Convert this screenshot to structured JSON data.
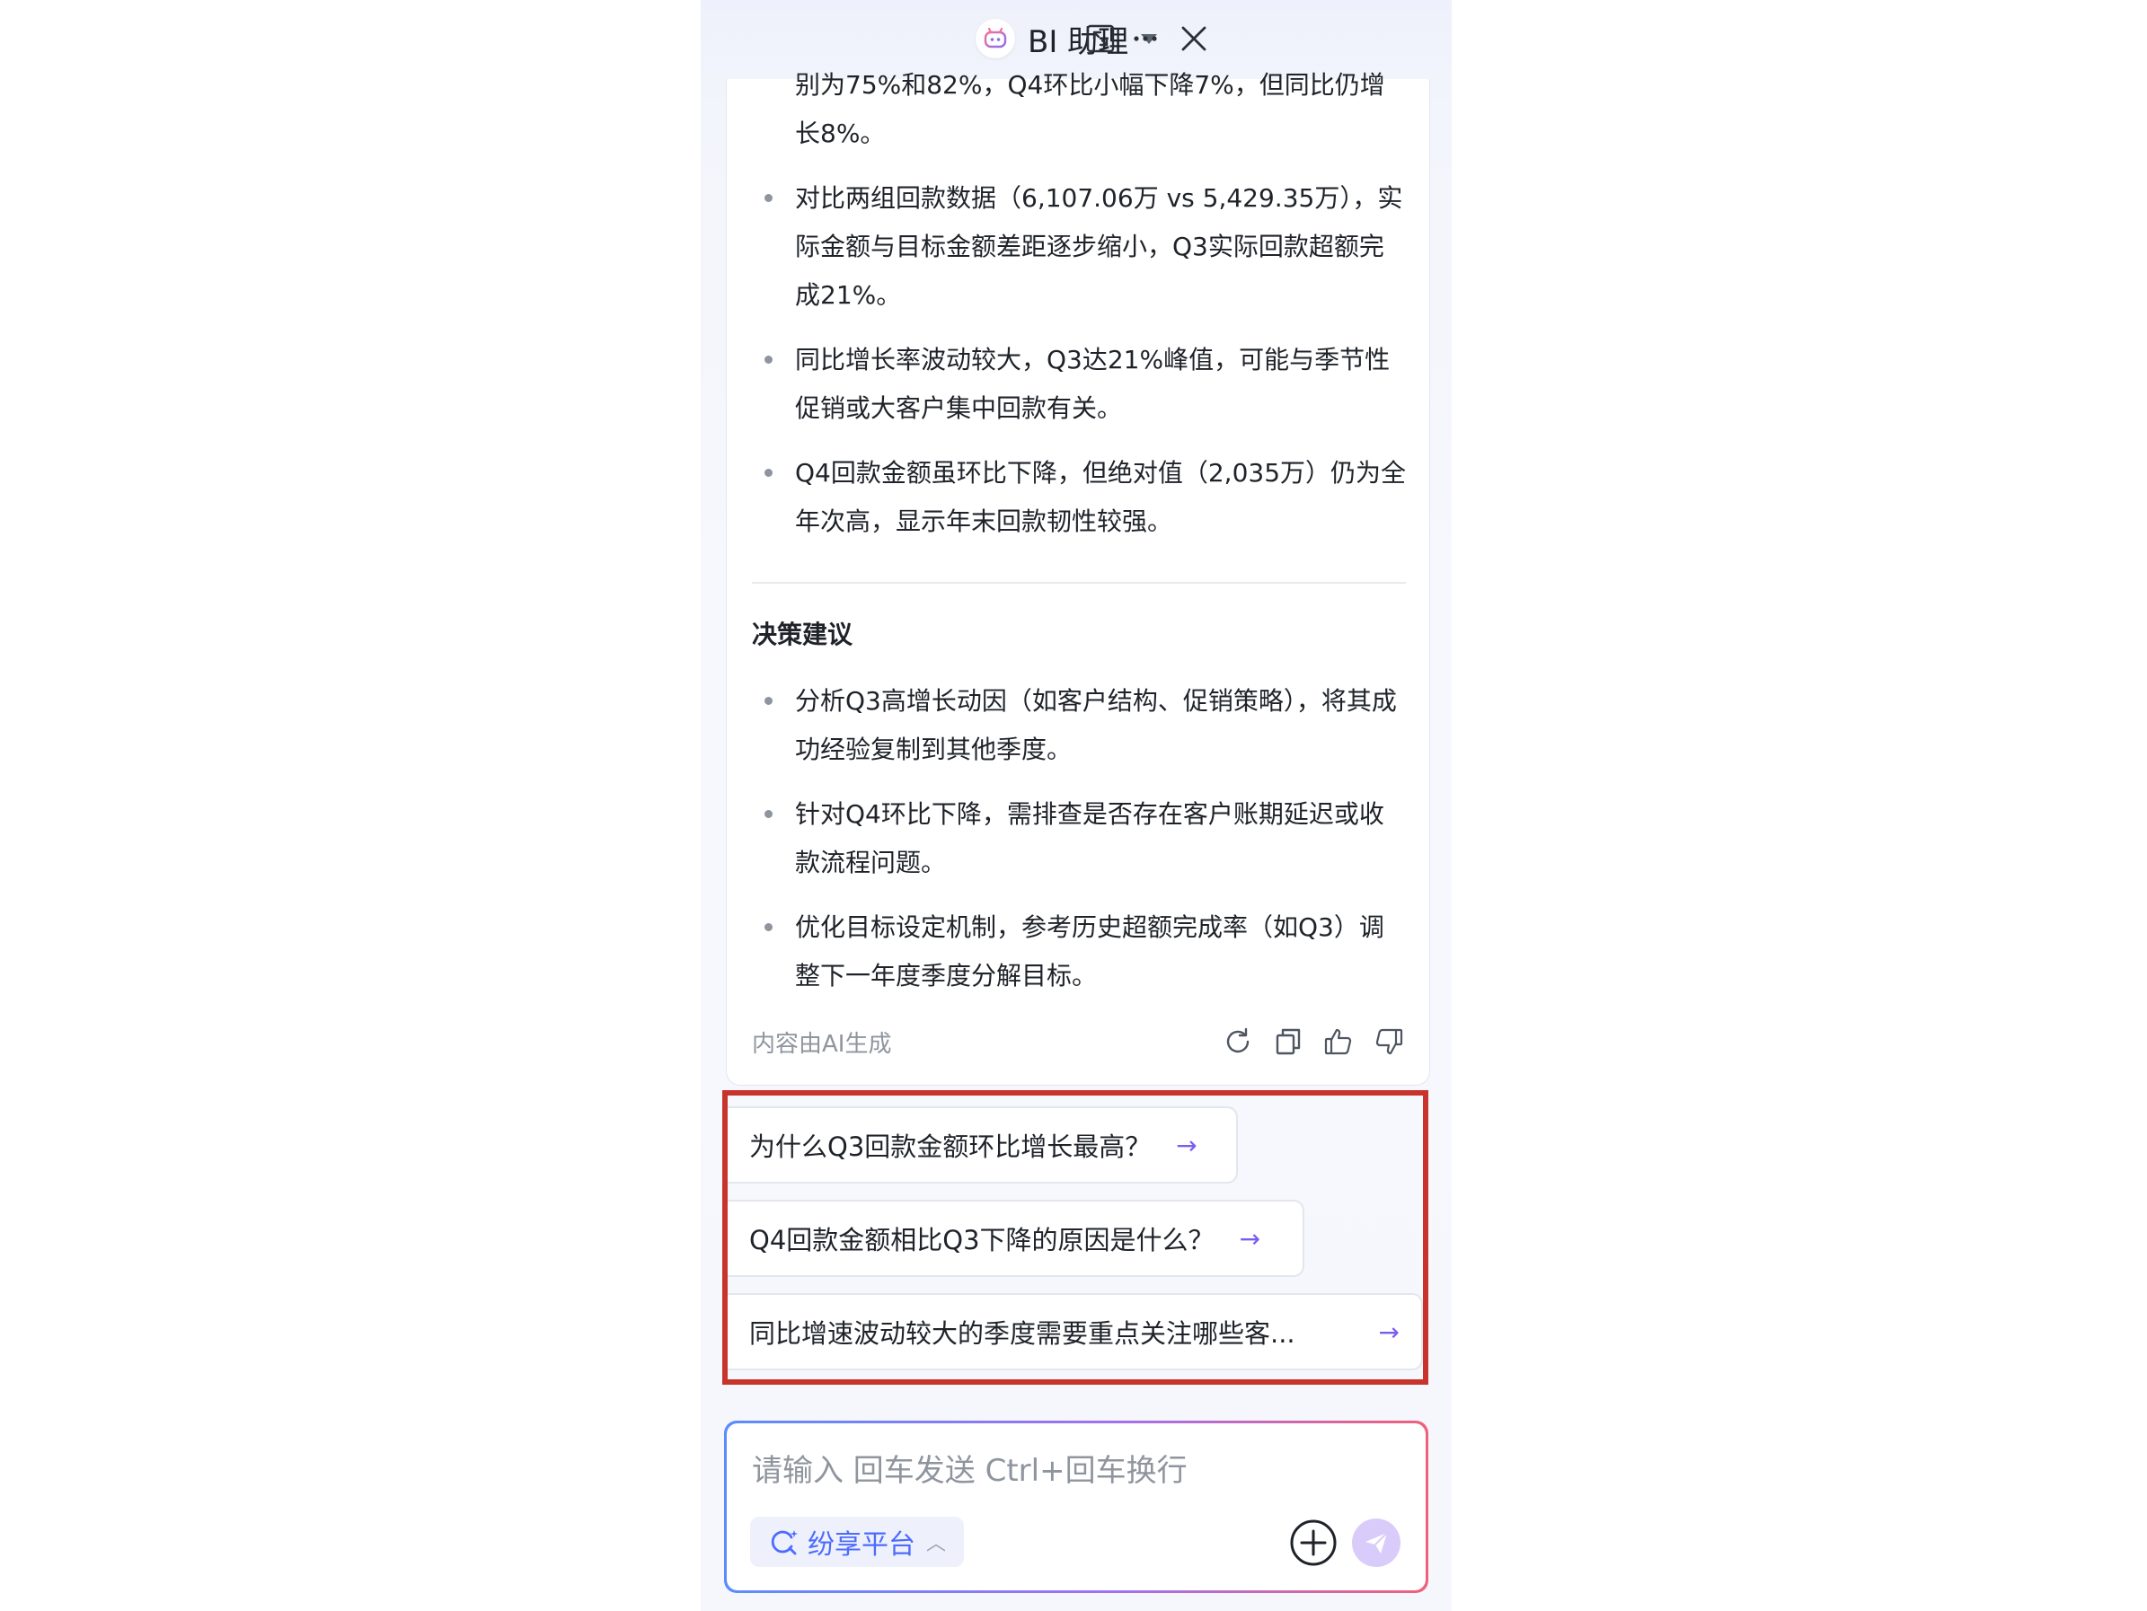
{
  "header": {
    "title": "BI 助理"
  },
  "answer": {
    "cut_line_1": "别为75%和82%，Q4环比小幅下降7%，但同比仍增",
    "cut_line_2": "长8%。",
    "bullets": [
      "对比两组回款数据（6,107.06万 vs 5,429.35万），实际金额与目标金额差距逐步缩小，Q3实际回款超额完成21%。",
      "同比增长率波动较大，Q3达21%峰值，可能与季节性促销或大客户集中回款有关。",
      "Q4回款金额虽环比下降，但绝对值（2,035万）仍为全年次高，显示年末回款韧性较强。"
    ],
    "section_title": "决策建议",
    "suggest_bullets": [
      "分析Q3高增长动因（如客户结构、促销策略），将其成功经验复制到其他季度。",
      "针对Q4环比下降，需排查是否存在客户账期延迟或收款流程问题。",
      "优化目标设定机制，参考历史超额完成率（如Q3）调整下一年度季度分解目标。"
    ],
    "ai_note": "内容由AI生成"
  },
  "suggestions": [
    {
      "text": "为什么Q3回款金额环比增长最高？",
      "arrow": "→"
    },
    {
      "text": "Q4回款金额相比Q3下降的原因是什么？",
      "arrow": "→"
    },
    {
      "text": "同比增速波动较大的季度需要重点关注哪些客...",
      "arrow": "→"
    }
  ],
  "input": {
    "placeholder": "请输入 回车发送 Ctrl+回车换行",
    "platform_label": "纷享平台"
  },
  "colors": {
    "accent": "#7b5cf0",
    "highlight_border": "#c8342b",
    "platform_text": "#4d6bfe"
  }
}
